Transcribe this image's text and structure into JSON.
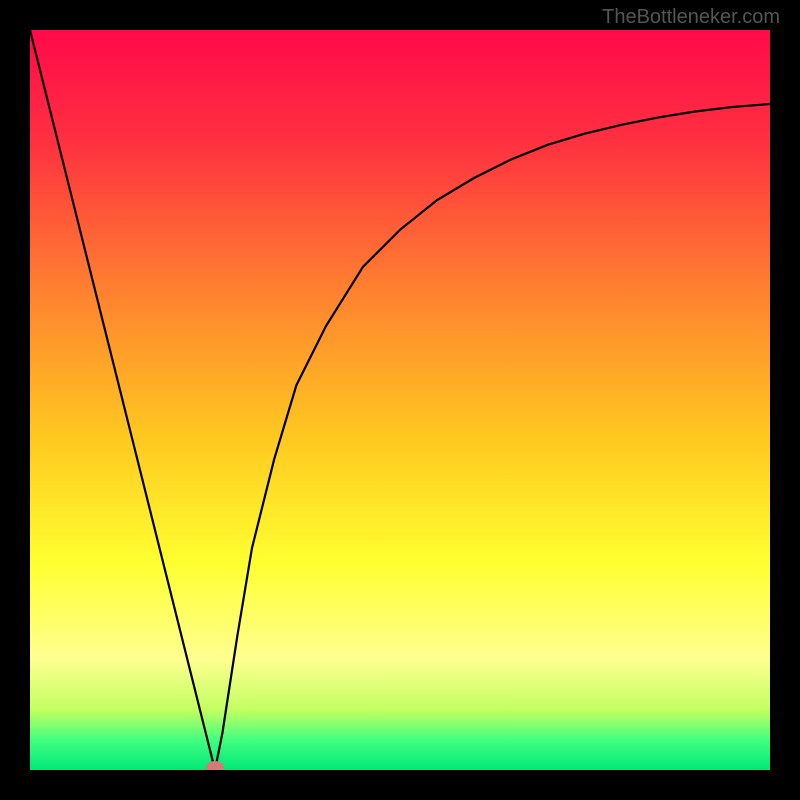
{
  "watermark": "TheBottleneker.com",
  "chart_data": {
    "type": "line",
    "title": "",
    "xlabel": "",
    "ylabel": "",
    "xlim": [
      0,
      100
    ],
    "ylim": [
      0,
      100
    ],
    "gradient_stops": [
      {
        "offset": 0,
        "color": "#ff0a4a"
      },
      {
        "offset": 15,
        "color": "#ff3040"
      },
      {
        "offset": 35,
        "color": "#ff8030"
      },
      {
        "offset": 55,
        "color": "#ffc820"
      },
      {
        "offset": 72,
        "color": "#ffff30"
      },
      {
        "offset": 85,
        "color": "#ffff90"
      },
      {
        "offset": 92,
        "color": "#c0ff60"
      },
      {
        "offset": 96,
        "color": "#40ff80"
      },
      {
        "offset": 100,
        "color": "#00e878"
      }
    ],
    "series": [
      {
        "name": "bottleneck-curve",
        "x": [
          0,
          5,
          10,
          15,
          20,
          22,
          24,
          25,
          26,
          28,
          30,
          33,
          36,
          40,
          45,
          50,
          55,
          60,
          65,
          70,
          75,
          80,
          85,
          90,
          95,
          100
        ],
        "values": [
          100,
          80,
          60,
          40,
          20,
          12,
          4,
          0,
          5,
          18,
          30,
          42,
          52,
          60,
          68,
          73,
          77,
          80,
          82.5,
          84.5,
          86,
          87.2,
          88.2,
          89,
          89.6,
          90
        ]
      }
    ],
    "marker": {
      "x": 25,
      "y": 0,
      "color": "#d47a7a"
    }
  }
}
